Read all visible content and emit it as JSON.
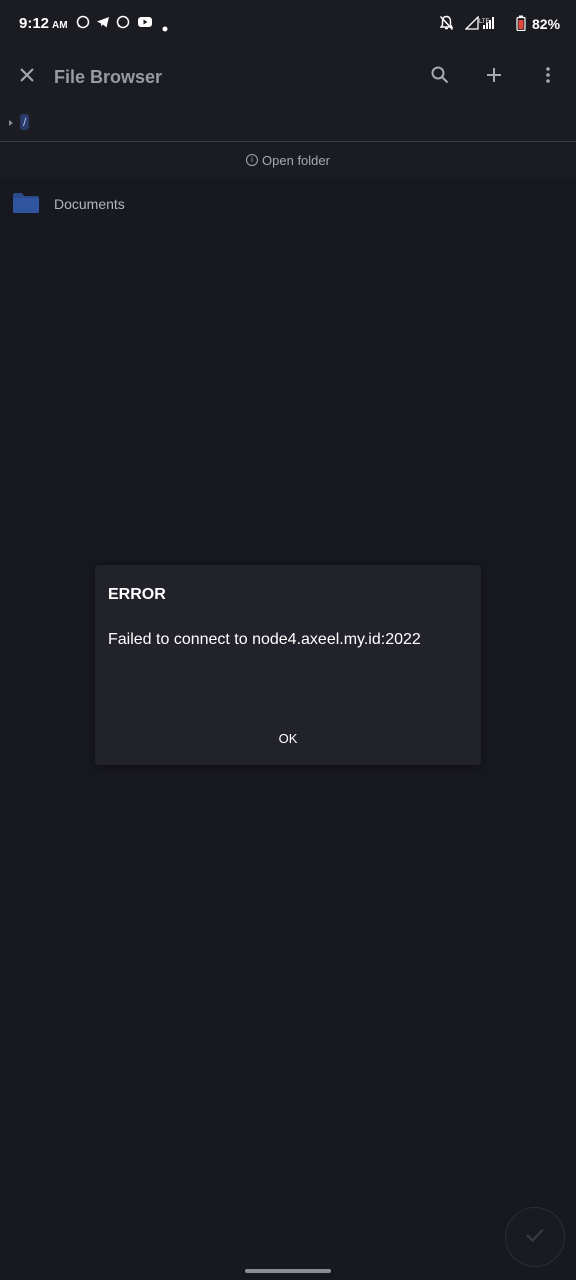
{
  "status_bar": {
    "time": "9:12",
    "ampm": "AM",
    "battery": "82%",
    "icons": [
      "whatsapp-icon",
      "telegram-icon",
      "whatsapp-icon",
      "youtube-icon",
      "notification-dot-icon",
      "notifications-off-icon",
      "signal-lte-icon",
      "signal-bars-icon",
      "battery-icon"
    ]
  },
  "app_bar": {
    "title": "File Browser",
    "close_icon": "close-icon",
    "search_icon": "search-icon",
    "add_icon": "add-icon",
    "more_icon": "more-vertical-icon"
  },
  "breadcrumb": {
    "root": "/"
  },
  "open_folder": {
    "label": "Open folder",
    "info_icon": "info-icon"
  },
  "files": [
    {
      "name": "Documents",
      "icon": "folder-icon"
    }
  ],
  "dialog": {
    "title": "ERROR",
    "message": "Failed to connect to node4.axeel.my.id:2022",
    "ok_label": "OK"
  },
  "fab": {
    "icon": "check-icon"
  },
  "colors": {
    "background": "#181820",
    "app_bar": "#1b1b22",
    "dialog": "#22222b",
    "folder": "#2a4a8a",
    "title_text": "#9a9aa2"
  }
}
